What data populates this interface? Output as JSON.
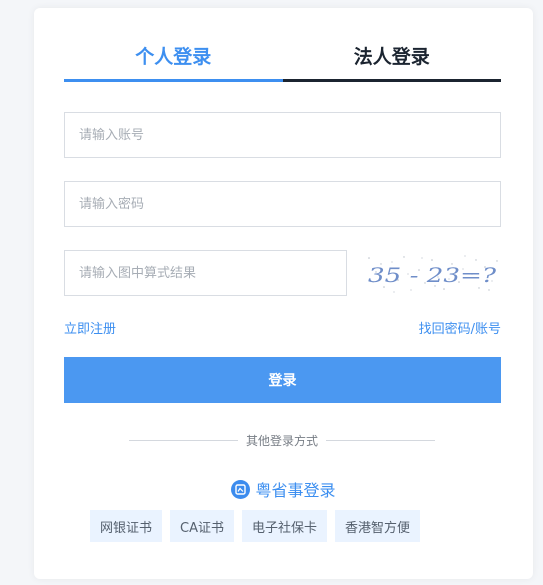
{
  "tabs": [
    {
      "label": "个人登录",
      "active": true
    },
    {
      "label": "法人登录",
      "active": false
    }
  ],
  "form": {
    "account_placeholder": "请输入账号",
    "password_placeholder": "请输入密码",
    "captcha_placeholder": "请输入图中算式结果",
    "captcha_text": "35 - 23=?"
  },
  "links": {
    "register": "立即注册",
    "recover": "找回密码/账号"
  },
  "login_button": "登录",
  "other_methods": {
    "title": "其他登录方式",
    "gov_app_label": "粤省事登录",
    "gov_app_icon": "guangdong-app-icon",
    "options": [
      "网银证书",
      "CA证书",
      "电子社保卡",
      "香港智方便"
    ]
  },
  "colors": {
    "accent": "#3d8ff0",
    "button": "#4b98f1",
    "inactive_tab": "#1b2430",
    "chip_bg": "#eaf3ff"
  }
}
